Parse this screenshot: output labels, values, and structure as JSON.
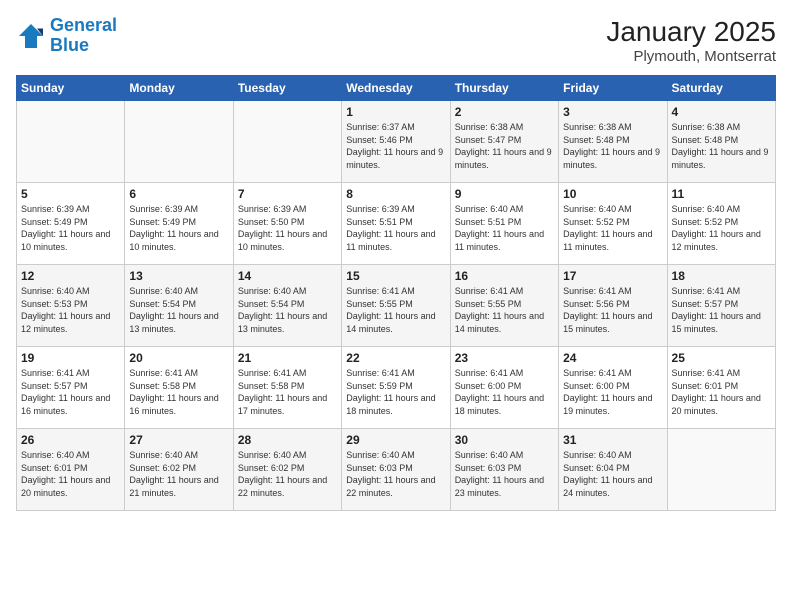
{
  "header": {
    "logo_line1": "General",
    "logo_line2": "Blue",
    "main_title": "January 2025",
    "sub_title": "Plymouth, Montserrat"
  },
  "days_of_week": [
    "Sunday",
    "Monday",
    "Tuesday",
    "Wednesday",
    "Thursday",
    "Friday",
    "Saturday"
  ],
  "weeks": [
    [
      {
        "day": "",
        "info": ""
      },
      {
        "day": "",
        "info": ""
      },
      {
        "day": "",
        "info": ""
      },
      {
        "day": "1",
        "info": "Sunrise: 6:37 AM\nSunset: 5:46 PM\nDaylight: 11 hours and 9 minutes."
      },
      {
        "day": "2",
        "info": "Sunrise: 6:38 AM\nSunset: 5:47 PM\nDaylight: 11 hours and 9 minutes."
      },
      {
        "day": "3",
        "info": "Sunrise: 6:38 AM\nSunset: 5:48 PM\nDaylight: 11 hours and 9 minutes."
      },
      {
        "day": "4",
        "info": "Sunrise: 6:38 AM\nSunset: 5:48 PM\nDaylight: 11 hours and 9 minutes."
      }
    ],
    [
      {
        "day": "5",
        "info": "Sunrise: 6:39 AM\nSunset: 5:49 PM\nDaylight: 11 hours and 10 minutes."
      },
      {
        "day": "6",
        "info": "Sunrise: 6:39 AM\nSunset: 5:49 PM\nDaylight: 11 hours and 10 minutes."
      },
      {
        "day": "7",
        "info": "Sunrise: 6:39 AM\nSunset: 5:50 PM\nDaylight: 11 hours and 10 minutes."
      },
      {
        "day": "8",
        "info": "Sunrise: 6:39 AM\nSunset: 5:51 PM\nDaylight: 11 hours and 11 minutes."
      },
      {
        "day": "9",
        "info": "Sunrise: 6:40 AM\nSunset: 5:51 PM\nDaylight: 11 hours and 11 minutes."
      },
      {
        "day": "10",
        "info": "Sunrise: 6:40 AM\nSunset: 5:52 PM\nDaylight: 11 hours and 11 minutes."
      },
      {
        "day": "11",
        "info": "Sunrise: 6:40 AM\nSunset: 5:52 PM\nDaylight: 11 hours and 12 minutes."
      }
    ],
    [
      {
        "day": "12",
        "info": "Sunrise: 6:40 AM\nSunset: 5:53 PM\nDaylight: 11 hours and 12 minutes."
      },
      {
        "day": "13",
        "info": "Sunrise: 6:40 AM\nSunset: 5:54 PM\nDaylight: 11 hours and 13 minutes."
      },
      {
        "day": "14",
        "info": "Sunrise: 6:40 AM\nSunset: 5:54 PM\nDaylight: 11 hours and 13 minutes."
      },
      {
        "day": "15",
        "info": "Sunrise: 6:41 AM\nSunset: 5:55 PM\nDaylight: 11 hours and 14 minutes."
      },
      {
        "day": "16",
        "info": "Sunrise: 6:41 AM\nSunset: 5:55 PM\nDaylight: 11 hours and 14 minutes."
      },
      {
        "day": "17",
        "info": "Sunrise: 6:41 AM\nSunset: 5:56 PM\nDaylight: 11 hours and 15 minutes."
      },
      {
        "day": "18",
        "info": "Sunrise: 6:41 AM\nSunset: 5:57 PM\nDaylight: 11 hours and 15 minutes."
      }
    ],
    [
      {
        "day": "19",
        "info": "Sunrise: 6:41 AM\nSunset: 5:57 PM\nDaylight: 11 hours and 16 minutes."
      },
      {
        "day": "20",
        "info": "Sunrise: 6:41 AM\nSunset: 5:58 PM\nDaylight: 11 hours and 16 minutes."
      },
      {
        "day": "21",
        "info": "Sunrise: 6:41 AM\nSunset: 5:58 PM\nDaylight: 11 hours and 17 minutes."
      },
      {
        "day": "22",
        "info": "Sunrise: 6:41 AM\nSunset: 5:59 PM\nDaylight: 11 hours and 18 minutes."
      },
      {
        "day": "23",
        "info": "Sunrise: 6:41 AM\nSunset: 6:00 PM\nDaylight: 11 hours and 18 minutes."
      },
      {
        "day": "24",
        "info": "Sunrise: 6:41 AM\nSunset: 6:00 PM\nDaylight: 11 hours and 19 minutes."
      },
      {
        "day": "25",
        "info": "Sunrise: 6:41 AM\nSunset: 6:01 PM\nDaylight: 11 hours and 20 minutes."
      }
    ],
    [
      {
        "day": "26",
        "info": "Sunrise: 6:40 AM\nSunset: 6:01 PM\nDaylight: 11 hours and 20 minutes."
      },
      {
        "day": "27",
        "info": "Sunrise: 6:40 AM\nSunset: 6:02 PM\nDaylight: 11 hours and 21 minutes."
      },
      {
        "day": "28",
        "info": "Sunrise: 6:40 AM\nSunset: 6:02 PM\nDaylight: 11 hours and 22 minutes."
      },
      {
        "day": "29",
        "info": "Sunrise: 6:40 AM\nSunset: 6:03 PM\nDaylight: 11 hours and 22 minutes."
      },
      {
        "day": "30",
        "info": "Sunrise: 6:40 AM\nSunset: 6:03 PM\nDaylight: 11 hours and 23 minutes."
      },
      {
        "day": "31",
        "info": "Sunrise: 6:40 AM\nSunset: 6:04 PM\nDaylight: 11 hours and 24 minutes."
      },
      {
        "day": "",
        "info": ""
      }
    ]
  ]
}
